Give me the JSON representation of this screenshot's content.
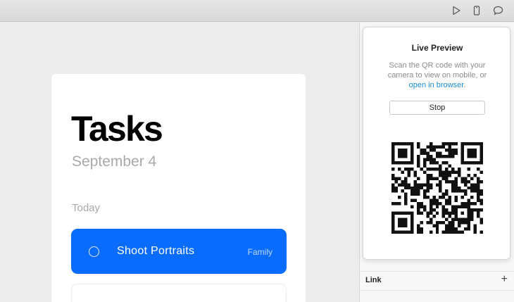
{
  "toolbar": {
    "icons": [
      "play-icon",
      "device-icon",
      "comment-icon"
    ]
  },
  "card": {
    "title": "Tasks",
    "date": "September 4",
    "section": "Today",
    "tasks": [
      {
        "label": "Shoot Portraits",
        "tag": "Family",
        "checked": false
      }
    ]
  },
  "preview": {
    "title": "Live Preview",
    "desc_line1": "Scan the QR code with your camera to view on mobile, or",
    "link_text": "open in browser",
    "desc_end": ".",
    "stop_label": "Stop"
  },
  "panel": {
    "link_label": "Link",
    "add_label": "+"
  },
  "colors": {
    "accent": "#0a6cff",
    "link": "#1a8ee0"
  }
}
